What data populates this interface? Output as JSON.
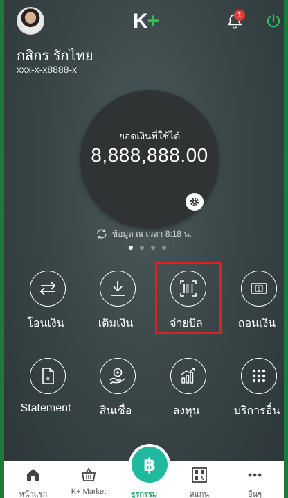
{
  "header": {
    "logo_k": "K",
    "logo_plus": "+",
    "notification_count": "1"
  },
  "user": {
    "name": "กสิกร รักไทย",
    "account": "xxx-x-x8888-x"
  },
  "balance": {
    "label": "ยอดเงินที่ใช้ได้",
    "value": "8,888,888.00",
    "updated": "ข้อมูล ณ เวลา 8:18 น."
  },
  "pager": {
    "dot_count": 4,
    "active_index": 0,
    "add_glyph": "+"
  },
  "actions": [
    {
      "label": "โอนเงิน",
      "icon": "transfer-icon"
    },
    {
      "label": "เติมเงิน",
      "icon": "topup-icon"
    },
    {
      "label": "จ่ายบิล",
      "icon": "barcode-icon",
      "highlighted": true
    },
    {
      "label": "ถอนเงิน",
      "icon": "withdraw-icon"
    },
    {
      "label": "Statement",
      "icon": "statement-icon"
    },
    {
      "label": "สินเชื่อ",
      "icon": "loan-icon"
    },
    {
      "label": "ลงทุน",
      "icon": "invest-icon"
    },
    {
      "label": "บริการอื่น",
      "icon": "more-services-icon"
    }
  ],
  "bottom_nav": [
    {
      "label": "หน้าแรก",
      "icon": "home-icon"
    },
    {
      "label": "K+ Market",
      "icon": "basket-icon"
    },
    {
      "label": "ธุรกรรม",
      "icon": "baht-icon",
      "active": true
    },
    {
      "label": "สแกน",
      "icon": "qr-scan-icon"
    },
    {
      "label": "อื่นๆ",
      "icon": "more-icon"
    }
  ],
  "colors": {
    "brand_green": "#1aa05b",
    "fab_teal": "#1fb9a0",
    "highlight_red": "#e01f1f",
    "badge_red": "#e53935"
  }
}
